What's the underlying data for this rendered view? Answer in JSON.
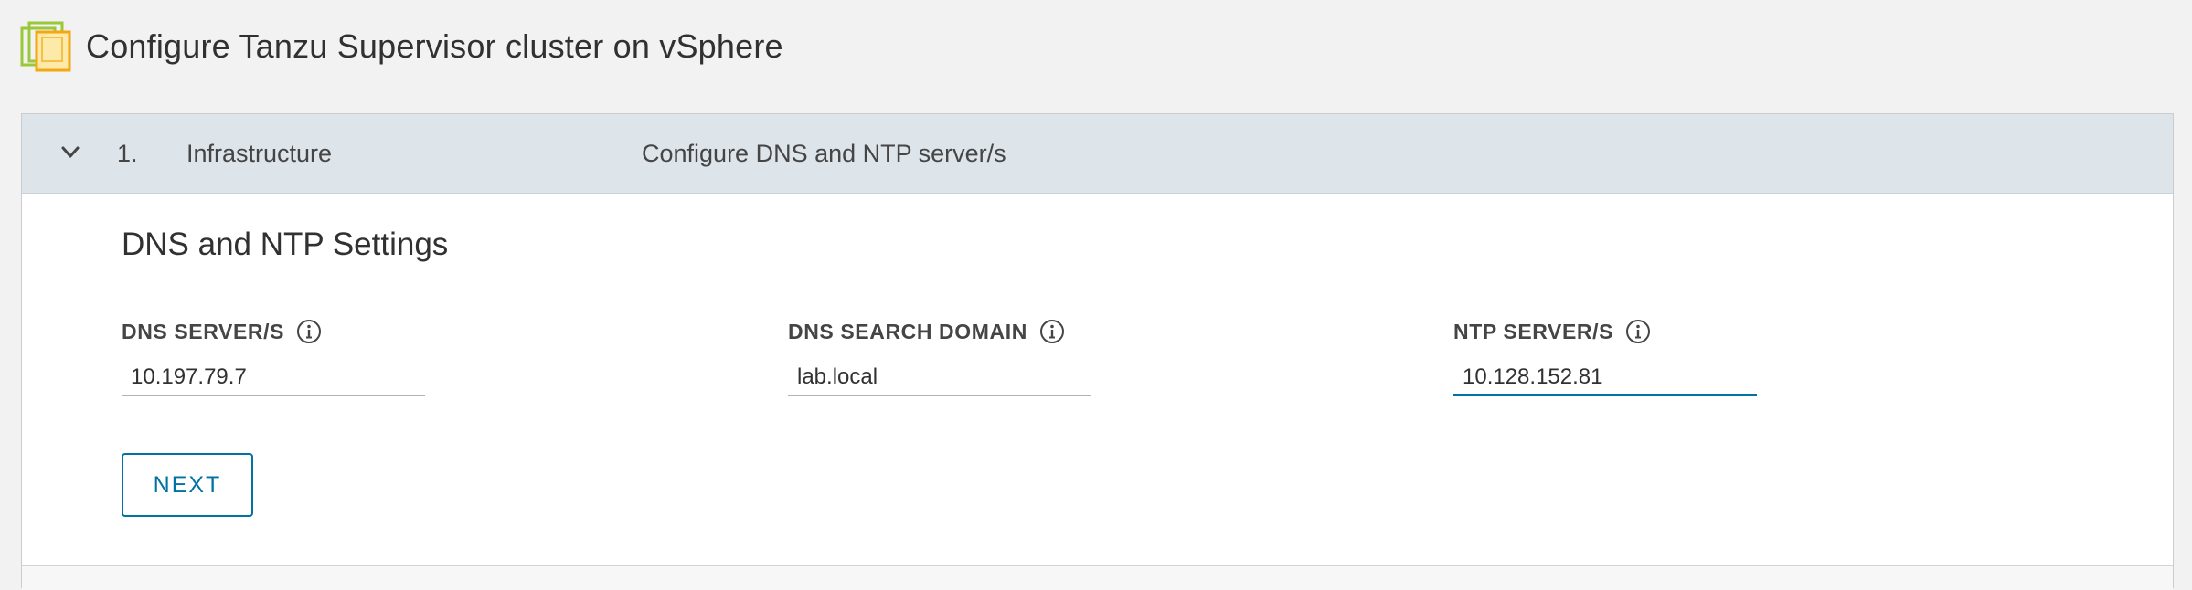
{
  "app": {
    "title": "Configure Tanzu Supervisor cluster on vSphere",
    "logo_icon": "vsphere-logo"
  },
  "wizard": {
    "step": {
      "number": "1.",
      "name": "Infrastructure",
      "description": "Configure DNS and NTP server/s",
      "expanded": true
    },
    "section_title": "DNS and NTP Settings",
    "fields": [
      {
        "label": "DNS SERVER/S",
        "value": "10.197.79.7",
        "icon": "info-icon"
      },
      {
        "label": "DNS SEARCH DOMAIN",
        "value": "lab.local",
        "icon": "info-icon"
      },
      {
        "label": "NTP SERVER/S",
        "value": "10.128.152.81",
        "icon": "info-icon",
        "focused": true
      }
    ],
    "next_label": "NEXT"
  },
  "colors": {
    "accent": "#0072a3",
    "header_bg": "#dde4ea",
    "page_bg": "#f2f2f2",
    "logo_green": "#9bc83b",
    "logo_orange": "#f3a712"
  }
}
